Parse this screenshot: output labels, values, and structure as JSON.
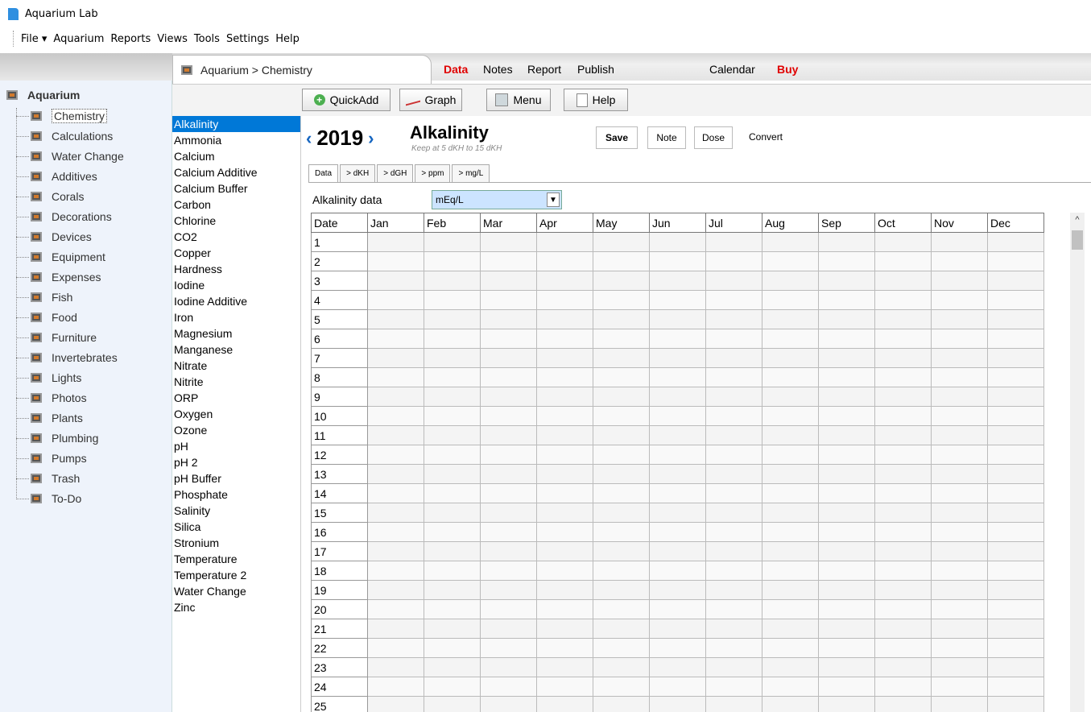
{
  "window": {
    "title": "Aquarium Lab"
  },
  "menubar": [
    "File ▾",
    "Aquarium",
    "Reports",
    "Views",
    "Tools",
    "Settings",
    "Help"
  ],
  "breadcrumb": "Aquarium > Chemistry",
  "topnav": {
    "data": "Data",
    "notes": "Notes",
    "report": "Report",
    "publish": "Publish",
    "calendar": "Calendar",
    "buy": "Buy"
  },
  "tree": {
    "root": "Aquarium",
    "items": [
      "Chemistry",
      "Calculations",
      "Water Change",
      "Additives",
      "Corals",
      "Decorations",
      "Devices",
      "Equipment",
      "Expenses",
      "Fish",
      "Food",
      "Furniture",
      "Invertebrates",
      "Lights",
      "Photos",
      "Plants",
      "Plumbing",
      "Pumps",
      "Trash",
      "To-Do"
    ],
    "selected": "Chemistry"
  },
  "toolbar": {
    "quickadd": "QuickAdd",
    "graph": "Graph",
    "menu": "Menu",
    "help": "Help"
  },
  "parameters": [
    "Alkalinity",
    "Ammonia",
    "Calcium",
    "Calcium Additive",
    "Calcium Buffer",
    "Carbon",
    "Chlorine",
    "CO2",
    "Copper",
    "Hardness",
    "Iodine",
    "Iodine Additive",
    "Iron",
    "Magnesium",
    "Manganese",
    "Nitrate",
    "Nitrite",
    "ORP",
    "Oxygen",
    "Ozone",
    "pH",
    "pH 2",
    "pH Buffer",
    "Phosphate",
    "Salinity",
    "Silica",
    "Stronium",
    "Temperature",
    "Temperature 2",
    "Water Change",
    "Zinc"
  ],
  "selected_parameter": "Alkalinity",
  "header": {
    "prev": "‹",
    "year": "2019",
    "next": "›",
    "title": "Alkalinity",
    "subtitle": "Keep at 5 dKH to 15 dKH",
    "save": "Save",
    "note": "Note",
    "dose": "Dose",
    "convert": "Convert"
  },
  "unit_tabs": [
    "Data",
    "> dKH",
    "> dGH",
    "> ppm",
    "> mg/L"
  ],
  "data_label": "Alkalinity data",
  "unit_select": "mEq/L",
  "grid": {
    "headers": [
      "Date",
      "Jan",
      "Feb",
      "Mar",
      "Apr",
      "May",
      "Jun",
      "Jul",
      "Aug",
      "Sep",
      "Oct",
      "Nov",
      "Dec"
    ],
    "days": [
      "1",
      "2",
      "3",
      "4",
      "5",
      "6",
      "7",
      "8",
      "9",
      "10",
      "11",
      "12",
      "13",
      "14",
      "15",
      "16",
      "17",
      "18",
      "19",
      "20",
      "21",
      "22",
      "23",
      "24",
      "25"
    ]
  },
  "scroll_up": "^"
}
